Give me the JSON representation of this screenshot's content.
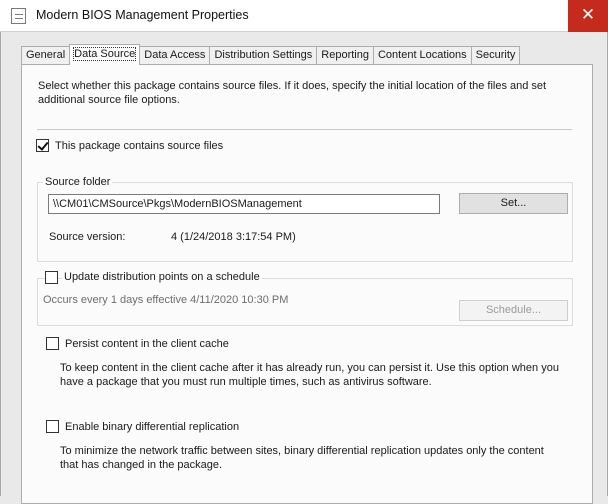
{
  "window": {
    "title": "Modern BIOS Management Properties",
    "close_glyph": "✕"
  },
  "tabs": [
    {
      "label": "General"
    },
    {
      "label": "Data Source"
    },
    {
      "label": "Data Access"
    },
    {
      "label": "Distribution Settings"
    },
    {
      "label": "Reporting"
    },
    {
      "label": "Content Locations"
    },
    {
      "label": "Security"
    }
  ],
  "intro_text": "Select whether this package contains source files. If it does, specify the initial location of the files and set additional source file options.",
  "contains_source": {
    "label": "This package contains source files",
    "checked": true
  },
  "source_folder": {
    "group_label": "Source folder",
    "path": "\\\\CM01\\CMSource\\Pkgs\\ModernBIOSManagement",
    "set_button": "Set...",
    "version_label": "Source version:",
    "version_value": "4 (1/24/2018 3:17:54 PM)"
  },
  "update_schedule": {
    "label": "Update distribution points on a schedule",
    "checked": false,
    "schedule_text": "Occurs every 1 days effective 4/11/2020 10:30 PM",
    "schedule_button": "Schedule..."
  },
  "persist_cache": {
    "label": "Persist content in the client cache",
    "checked": false,
    "description": "To keep content in the client cache after it has already run, you can persist it. Use this option when you have  a package that you must run multiple times, such as antivirus software."
  },
  "binary_replication": {
    "label": "Enable binary differential replication",
    "checked": false,
    "description": "To minimize the network traffic between sites, binary differential replication updates only the content that has changed in the package."
  }
}
